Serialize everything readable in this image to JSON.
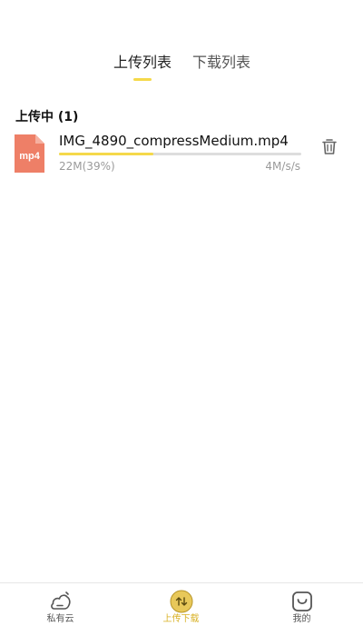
{
  "tabs": {
    "upload": "上传列表",
    "download": "下载列表",
    "active": "upload"
  },
  "section": {
    "title": "上传中 (1)"
  },
  "uploads": [
    {
      "file_type": "mp4",
      "file_name": "IMG_4890_compressMedium.mp4",
      "size_progress": "22M(39%)",
      "speed": "4M/s/s",
      "progress": 0.39,
      "icon": "trash-icon"
    }
  ],
  "bottom_nav": {
    "items": [
      {
        "label": "私有云",
        "icon": "cloud-icon",
        "active": false
      },
      {
        "label": "上传下载",
        "icon": "transfer-icon",
        "active": true
      },
      {
        "label": "我的",
        "icon": "profile-icon",
        "active": false
      }
    ]
  },
  "colors": {
    "accent": "#f5d94a",
    "active_nav_text": "#d9b227",
    "file_icon": "#ee7f67",
    "muted_text": "#9a9a9a"
  }
}
